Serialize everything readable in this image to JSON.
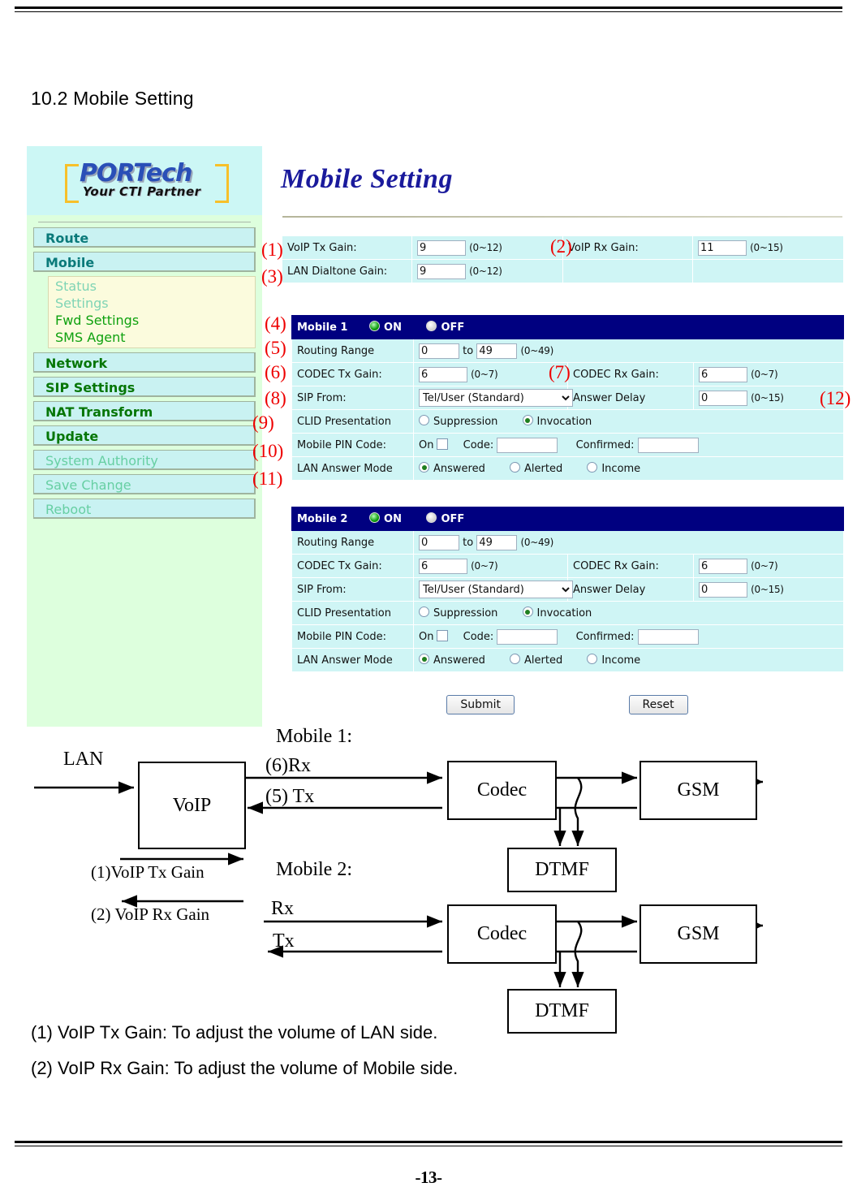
{
  "document": {
    "heading": "10.2 Mobile Setting",
    "page_number": "-13-",
    "notes": [
      "(1) VoIP Tx Gain: To adjust the volume of LAN side.",
      "(2) VoIP Rx Gain: To adjust the volume of Mobile side."
    ]
  },
  "app": {
    "logo": {
      "main": "PORTech",
      "sub": "Your CTI Partner"
    },
    "page_title": "Mobile Setting",
    "sidebar": {
      "items": [
        {
          "label": "Route",
          "style": "teal"
        },
        {
          "label": "Mobile",
          "style": "teal"
        }
      ],
      "sub_items": [
        {
          "label": "Status",
          "active": false
        },
        {
          "label": "Settings",
          "active": false
        },
        {
          "label": "Fwd Settings",
          "active": true
        },
        {
          "label": "SMS Agent",
          "active": true
        }
      ],
      "items2": [
        {
          "label": "Network",
          "style": "green"
        },
        {
          "label": "SIP Settings",
          "style": "green"
        },
        {
          "label": "NAT Transform",
          "style": "green"
        },
        {
          "label": "Update",
          "style": "green"
        },
        {
          "label": "System Authority",
          "style": "pale"
        },
        {
          "label": "Save Change",
          "style": "pale"
        },
        {
          "label": "Reboot",
          "style": "pale"
        }
      ]
    },
    "top_settings": {
      "voip_tx_gain": {
        "label": "VoIP Tx Gain:",
        "value": "9",
        "range": "(0~12)"
      },
      "voip_rx_gain": {
        "label": "VoIP Rx Gain:",
        "value": "11",
        "range": "(0~15)"
      },
      "lan_dialtone_gain": {
        "label": "LAN Dialtone Gain:",
        "value": "9",
        "range": "(0~12)"
      }
    },
    "mobiles": [
      {
        "title": "Mobile 1",
        "power": {
          "on_label": "ON",
          "off_label": "OFF",
          "selected": "ON"
        },
        "routing_range": {
          "label": "Routing Range",
          "from": "0",
          "to_label": "to",
          "to": "49",
          "range": "(0~49)"
        },
        "codec_tx_gain": {
          "label": "CODEC Tx Gain:",
          "value": "6",
          "range": "(0~7)"
        },
        "codec_rx_gain": {
          "label": "CODEC Rx Gain:",
          "value": "6",
          "range": "(0~7)"
        },
        "sip_from": {
          "label": "SIP From:",
          "value": "Tel/User (Standard)",
          "options": [
            "Tel/User (Standard)"
          ]
        },
        "answer_delay": {
          "label": "Answer Delay",
          "value": "0",
          "range": "(0~15)"
        },
        "clid_presentation": {
          "label": "CLID Presentation",
          "options": [
            "Suppression",
            "Invocation"
          ],
          "selected": "Invocation"
        },
        "mobile_pin_code": {
          "label": "Mobile PIN Code:",
          "on_label": "On",
          "checked": false,
          "code_label": "Code:",
          "code_value": "",
          "confirmed_label": "Confirmed:",
          "confirmed_value": ""
        },
        "lan_answer_mode": {
          "label": "LAN Answer Mode",
          "options": [
            "Answered",
            "Alerted",
            "Income"
          ],
          "selected": "Answered"
        }
      },
      {
        "title": "Mobile 2",
        "power": {
          "on_label": "ON",
          "off_label": "OFF",
          "selected": "ON"
        },
        "routing_range": {
          "label": "Routing Range",
          "from": "0",
          "to_label": "to",
          "to": "49",
          "range": "(0~49)"
        },
        "codec_tx_gain": {
          "label": "CODEC Tx Gain:",
          "value": "6",
          "range": "(0~7)"
        },
        "codec_rx_gain": {
          "label": "CODEC Rx Gain:",
          "value": "6",
          "range": "(0~7)"
        },
        "sip_from": {
          "label": "SIP From:",
          "value": "Tel/User (Standard)",
          "options": [
            "Tel/User (Standard)"
          ]
        },
        "answer_delay": {
          "label": "Answer Delay",
          "value": "0",
          "range": "(0~15)"
        },
        "clid_presentation": {
          "label": "CLID Presentation",
          "options": [
            "Suppression",
            "Invocation"
          ],
          "selected": "Invocation"
        },
        "mobile_pin_code": {
          "label": "Mobile PIN Code:",
          "on_label": "On",
          "checked": false,
          "code_label": "Code:",
          "code_value": "",
          "confirmed_label": "Confirmed:",
          "confirmed_value": ""
        },
        "lan_answer_mode": {
          "label": "LAN Answer Mode",
          "options": [
            "Answered",
            "Alerted",
            "Income"
          ],
          "selected": "Answered"
        }
      }
    ],
    "buttons": {
      "submit": "Submit",
      "reset": "Reset"
    }
  },
  "callouts": {
    "c1": "(1)",
    "c2": "(2)",
    "c3": "(3)",
    "c4": "(4)",
    "c5": "(5)",
    "c6": "(6)",
    "c7": "(7)",
    "c8": "(8)",
    "c9": "(9)",
    "c10": "(10)",
    "c11": "(11)",
    "c12": "(12)"
  },
  "diagram": {
    "mobile1_label": "Mobile 1:",
    "mobile2_label": "Mobile 2:",
    "lan_label": "LAN",
    "voip_box": "VoIP",
    "m1_rx": "(6)Rx",
    "m1_tx": "(5) Tx",
    "m1_codec": "Codec",
    "m1_gsm": "GSM",
    "m1_dtmf": "DTMF",
    "tx_gain_label": "(1)VoIP Tx Gain",
    "rx_gain_label": "(2) VoIP Rx Gain",
    "m2_rx": "Rx",
    "m2_tx": "Tx",
    "m2_codec": "Codec",
    "m2_gsm": "GSM",
    "m2_dtmf": "DTMF"
  },
  "colors": {
    "header_navy": "#000080",
    "field_cyan": "#cff5f5",
    "sidebar_green": "#ddffdd",
    "nav_cyan": "#c9f2f2",
    "callout_red": "#ee0000",
    "title_blue": "#1a1a9c"
  }
}
